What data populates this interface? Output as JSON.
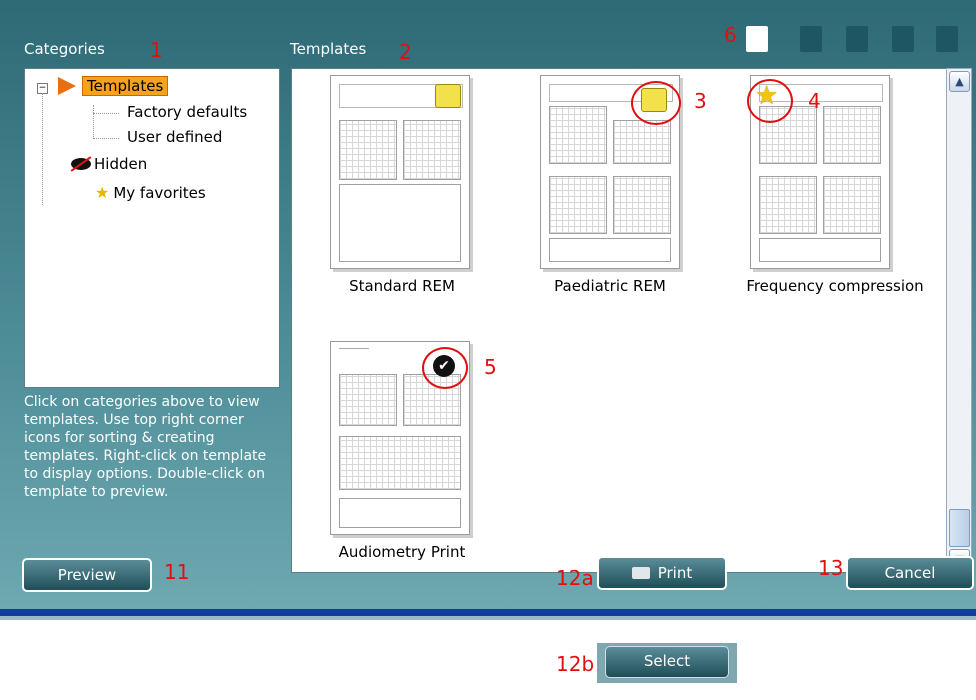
{
  "categories": {
    "title": "Categories",
    "tree": {
      "root": "Templates",
      "children": [
        "Factory defaults",
        "User defined"
      ],
      "hidden": "Hidden",
      "favorites": "My favorites"
    },
    "help": "Click on categories above to view templates. Use top right corner icons for sorting & creating templates. Right-click on template to display options. Double-click on template to preview."
  },
  "templates": {
    "title": "Templates",
    "items": [
      {
        "name": "Standard REM",
        "badge": "lock"
      },
      {
        "name": "Paediatric REM",
        "badge": "lock"
      },
      {
        "name": "Frequency compression",
        "badge": "star"
      },
      {
        "name": "Audiometry Print",
        "badge": "check"
      }
    ]
  },
  "callouts": {
    "n1": "1",
    "n2": "2",
    "n3": "3",
    "n4": "4",
    "n5": "5",
    "n6": "6",
    "n11": "11",
    "n12a": "12a",
    "n12b": "12b",
    "n13": "13"
  },
  "buttons": {
    "preview": "Preview",
    "print": "Print",
    "cancel": "Cancel",
    "select": "Select"
  },
  "colors": {
    "dialog": "#2e6a76",
    "selection": "#f6a21c",
    "callout": "#e01010"
  }
}
